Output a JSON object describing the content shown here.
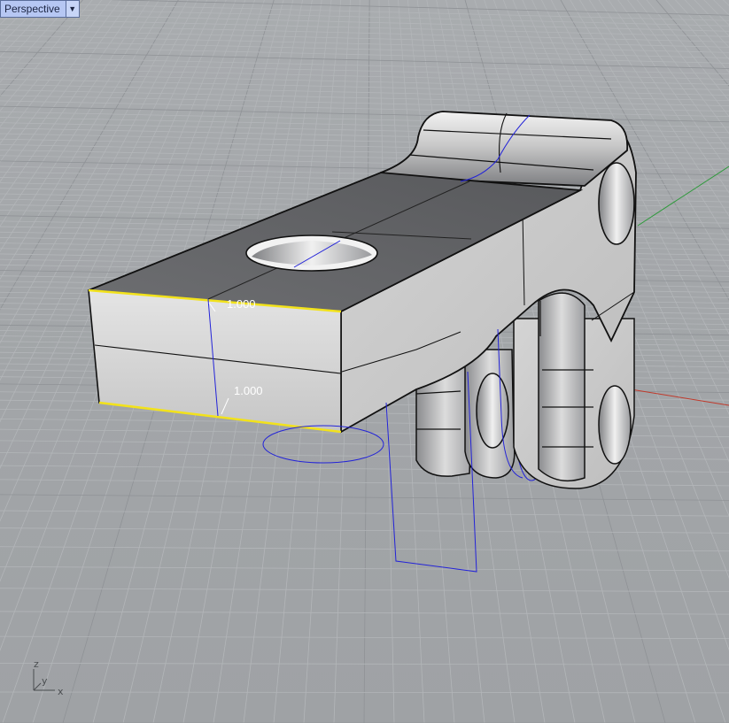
{
  "viewport": {
    "name": "Perspective",
    "menu_icon": "dropdown-arrow-icon"
  },
  "dimensions": {
    "top_edge_length": "1.000",
    "height": "1.000"
  },
  "axes": {
    "z": "z",
    "y": "y",
    "x": "x"
  },
  "colors": {
    "background": "#a3a6a9",
    "grid_minor": "#b3b6b9",
    "grid_major": "#8f9296",
    "x_axis": "#c0392b",
    "y_axis": "#2e9a3b",
    "selection": "#f2e21b",
    "curve": "#2323d8",
    "surface_light": "#d6d6d6",
    "surface_dark": "#5f6063"
  }
}
